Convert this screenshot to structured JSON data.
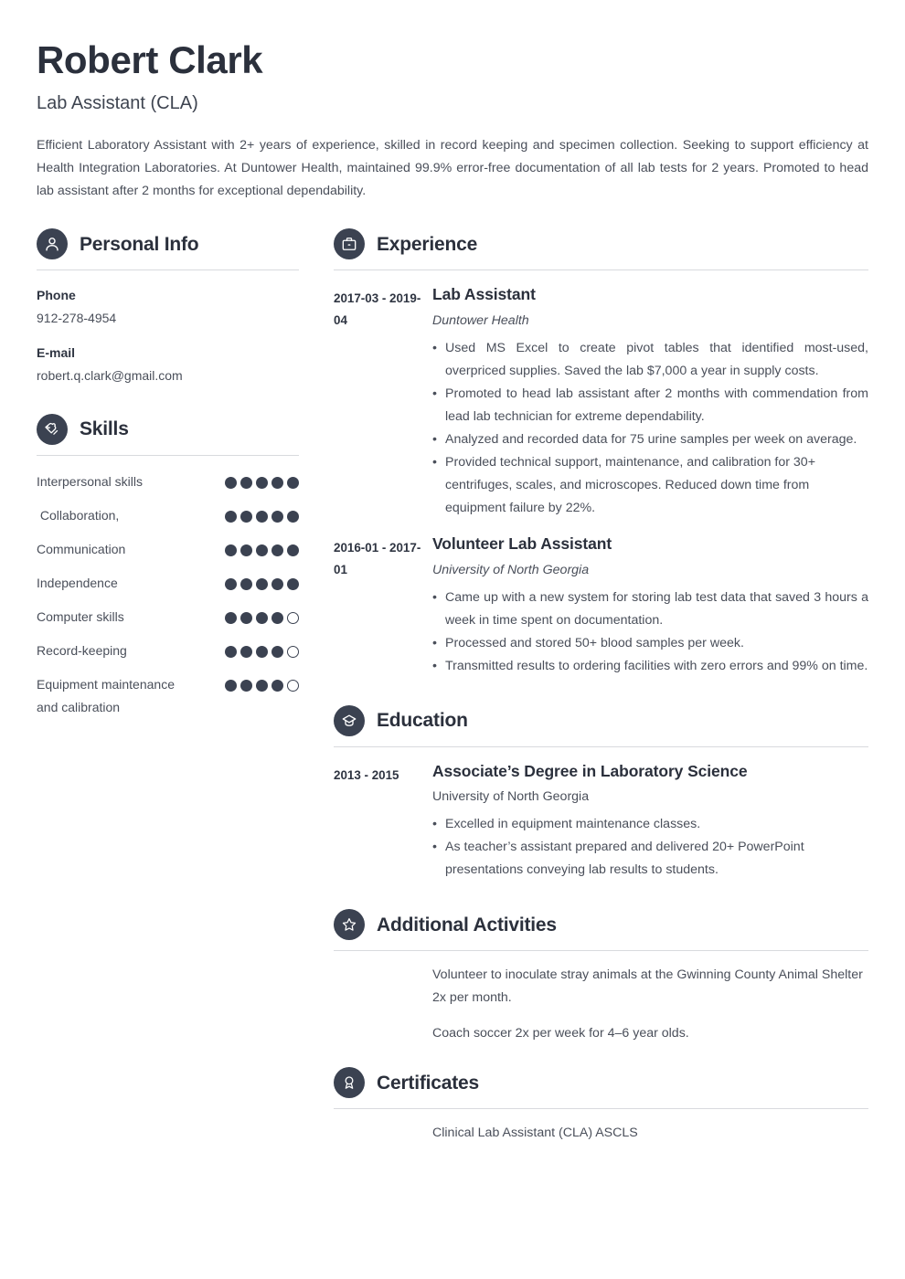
{
  "header": {
    "name": "Robert Clark",
    "job_title": "Lab Assistant (CLA)",
    "summary": "Efficient Laboratory Assistant with 2+ years of experience, skilled in record keeping and specimen collection. Seeking to support efficiency at Health Integration Laboratories. At Duntower Health, maintained 99.9% error-free documentation of all lab tests for 2 years. Promoted to head lab assistant after 2 months for exceptional dependability."
  },
  "personal_info": {
    "section_title": "Personal Info",
    "icon": "person-icon",
    "fields": [
      {
        "label": "Phone",
        "value": "912-278-4954"
      },
      {
        "label": "E-mail",
        "value": "robert.q.clark@gmail.com"
      }
    ]
  },
  "skills": {
    "section_title": "Skills",
    "icon": "puzzle-heart-icon",
    "max_rating": 5,
    "items": [
      {
        "name": "Interpersonal skills",
        "rating": 5
      },
      {
        "name": " Collaboration,",
        "rating": 5
      },
      {
        "name": "Communication",
        "rating": 5
      },
      {
        "name": "Independence",
        "rating": 5
      },
      {
        "name": "Computer skills",
        "rating": 4
      },
      {
        "name": "Record-keeping",
        "rating": 4
      },
      {
        "name": "Equipment maintenance and calibration",
        "rating": 4
      }
    ]
  },
  "experience": {
    "section_title": "Experience",
    "icon": "briefcase-icon",
    "entries": [
      {
        "dates": "2017-03 - 2019-04",
        "title": "Lab Assistant",
        "organization": "Duntower Health",
        "bullets": [
          "Used MS Excel to create pivot tables that identified most-used, overpriced supplies. Saved the lab $7,000 a year in supply costs.",
          "Promoted to head lab assistant after 2 months with commendation from lead lab technician for extreme dependability.",
          "Analyzed and recorded data for 75 urine samples per week on average.",
          "Provided technical support, maintenance, and calibration for 30+ centrifuges, scales, and microscopes. Reduced down time from equipment failure by 22%."
        ]
      },
      {
        "dates": "2016-01 - 2017-01",
        "title": "Volunteer Lab Assistant",
        "organization": "University of North Georgia",
        "bullets": [
          "Came up with a new system for storing lab test data that saved 3 hours a week in time spent on documentation.",
          "Processed and stored 50+ blood samples per week.",
          "Transmitted results to ordering facilities with zero errors and 99% on time."
        ]
      }
    ]
  },
  "education": {
    "section_title": "Education",
    "icon": "graduation-cap-icon",
    "entries": [
      {
        "dates": "2013 - 2015",
        "title": "Associate’s Degree in Laboratory Science",
        "organization": "University of North Georgia",
        "bullets": [
          "Excelled in equipment maintenance classes.",
          "As teacher’s assistant prepared and delivered 20+ PowerPoint presentations conveying lab results to students."
        ]
      }
    ]
  },
  "additional_activities": {
    "section_title": "Additional Activities",
    "icon": "star-icon",
    "items": [
      "Volunteer to inoculate stray animals at the Gwinning County Animal Shelter 2x per month.",
      "Coach soccer 2x per week for 4–6 year olds."
    ]
  },
  "certificates": {
    "section_title": "Certificates",
    "icon": "award-ribbon-icon",
    "items": [
      "Clinical Lab Assistant (CLA) ASCLS"
    ]
  },
  "colors": {
    "accent_dark": "#3b4251",
    "heading": "#2b303c",
    "body_text": "#4a4f5a",
    "rule": "#d8dade",
    "page_background": "#ffffff"
  }
}
